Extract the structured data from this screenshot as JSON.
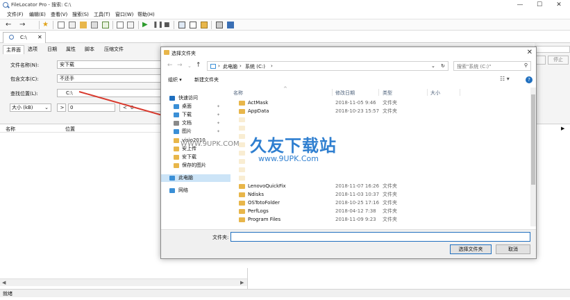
{
  "window": {
    "title": "FileLocator Pro - 搜索: C:\\",
    "controls": [
      "—",
      "☐",
      "✕"
    ]
  },
  "menu": [
    "文件(F)",
    "编辑(E)",
    "查看(V)",
    "搜索(S)",
    "工具(T)",
    "窗口(W)",
    "帮助(H)"
  ],
  "toolbar": {
    "icons": [
      "back-arrow-icon",
      "forward-arrow-icon",
      "favorite-star-icon",
      "new-file-icon",
      "copy-icon",
      "open-folder-icon",
      "save-icon",
      "export-icon",
      "page-icon",
      "page-lines-icon",
      "start-search-icon",
      "pause-icon",
      "stop-icon",
      "view-icon",
      "options-icon",
      "filter-icon",
      "print-icon",
      "book-icon"
    ],
    "back": "←",
    "forward": "→"
  },
  "doc_tab": {
    "label": "C:\\",
    "close": "✕"
  },
  "criteria": {
    "subtabs": [
      "主界面",
      "选项",
      "日期",
      "属性",
      "脚本",
      "压缩文件"
    ],
    "file_name_label": "文件名称(N):",
    "file_name_value": "安下载",
    "contains_label": "包含文本(C):",
    "contains_value": "不还手",
    "look_in_label": "查找位置(L):",
    "look_in_value": "C:\\",
    "size_select": "大小 (kB)",
    "size_op1": ">",
    "size_val1": "0",
    "size_op2": "<",
    "size_val2": "0"
  },
  "results_header": {
    "name": "名称",
    "location": "位置"
  },
  "right_buttons": {
    "button1": "",
    "button2": "停止"
  },
  "status": "就绪",
  "dialog": {
    "title": "选择文件夹",
    "close": "✕",
    "breadcrumb": [
      "此电脑",
      "系统 (C:)"
    ],
    "search_placeholder": "搜索\"系统 (C:)\"",
    "organize": "组织 ▾",
    "new_folder": "新建文件夹",
    "nav_items": [
      {
        "label": "快速访问",
        "icon": "star-icon",
        "color": "#1f6fbf"
      },
      {
        "label": "桌面",
        "icon": "desktop-icon",
        "color": "#3a8fd6",
        "pin": "📌"
      },
      {
        "label": "下载",
        "icon": "download-icon",
        "color": "#3a8fd6",
        "pin": "📌"
      },
      {
        "label": "文档",
        "icon": "document-icon",
        "color": "#8a8a8a",
        "pin": "📌"
      },
      {
        "label": "图片",
        "icon": "picture-icon",
        "color": "#3a8fd6",
        "pin": "📌"
      },
      {
        "label": "visio2010",
        "icon": "folder-icon",
        "color": "#e8b64a"
      },
      {
        "label": "安上传",
        "icon": "folder-icon",
        "color": "#e8b64a"
      },
      {
        "label": "安下载",
        "icon": "folder-icon",
        "color": "#e8b64a"
      },
      {
        "label": "保存的图片",
        "icon": "folder-icon",
        "color": "#e8b64a"
      },
      {
        "label": "此电脑",
        "icon": "computer-icon",
        "color": "#3a8fd6",
        "selected": true
      },
      {
        "label": "网络",
        "icon": "network-icon",
        "color": "#3a8fd6"
      }
    ],
    "columns": [
      "名称",
      "修改日期",
      "类型",
      "大小"
    ],
    "files": [
      {
        "name": "ActMask",
        "date": "2018-11-05 9:46",
        "type": "文件夹"
      },
      {
        "name": "AppData",
        "date": "2018-10-23 15:57",
        "type": "文件夹"
      },
      {
        "name": "",
        "date": "",
        "type": "",
        "faded": true
      },
      {
        "name": "",
        "date": "",
        "type": "",
        "faded": true
      },
      {
        "name": "",
        "date": "",
        "type": "",
        "faded": true
      },
      {
        "name": "",
        "date": "",
        "type": "",
        "faded": true
      },
      {
        "name": "",
        "date": "",
        "type": "",
        "faded": true
      },
      {
        "name": "",
        "date": "",
        "type": "",
        "faded": true
      },
      {
        "name": "",
        "date": "",
        "type": "",
        "faded": true
      },
      {
        "name": "",
        "date": "",
        "type": "",
        "faded": true
      },
      {
        "name": "LenovoQuickFix",
        "date": "2018-11-07 16:26",
        "type": "文件夹"
      },
      {
        "name": "Ndisks",
        "date": "2018-11-03 10:37",
        "type": "文件夹"
      },
      {
        "name": "OSTotoFolder",
        "date": "2018-10-25 17:16",
        "type": "文件夹"
      },
      {
        "name": "PerfLogs",
        "date": "2018-04-12 7:38",
        "type": "文件夹"
      },
      {
        "name": "Program Files",
        "date": "2018-11-09 9:23",
        "type": "文件夹"
      }
    ],
    "folder_label": "文件夹:",
    "select_button": "选择文件夹",
    "cancel_button": "取消"
  },
  "watermark": {
    "text": "久友下载站",
    "url": "www.9UPK.Com",
    "small": "WWW.9UPK.COM"
  },
  "colors": {
    "accent": "#1f6fbf",
    "arrow": "#d83a2e",
    "folder": "#e8b64a"
  }
}
